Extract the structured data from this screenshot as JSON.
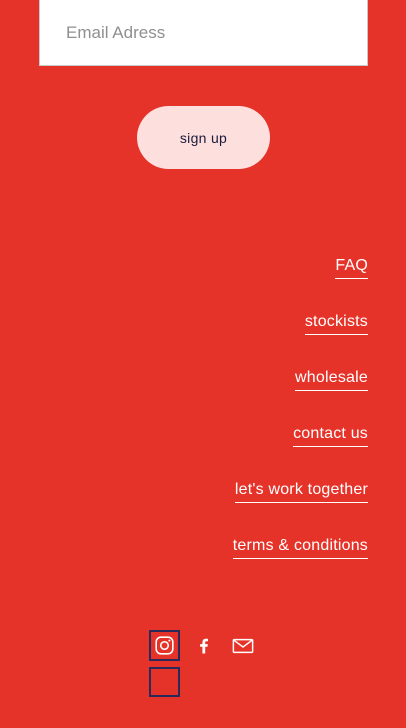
{
  "newsletter": {
    "email_placeholder": "Email Adress",
    "email_value": "",
    "signup_label": "sign up"
  },
  "footer_links": [
    {
      "label": "FAQ"
    },
    {
      "label": "stockists"
    },
    {
      "label": "wholesale"
    },
    {
      "label": "contact us"
    },
    {
      "label": "let's work together"
    },
    {
      "label": "terms & conditions"
    }
  ],
  "social": [
    {
      "name": "instagram-icon"
    },
    {
      "name": "facebook-icon"
    },
    {
      "name": "mail-icon"
    }
  ],
  "colors": {
    "background": "#e63329",
    "button_bg": "#fde0de",
    "button_text": "#1a1a3a",
    "link": "#ffffff",
    "focus_outline": "#2a2a5a"
  }
}
